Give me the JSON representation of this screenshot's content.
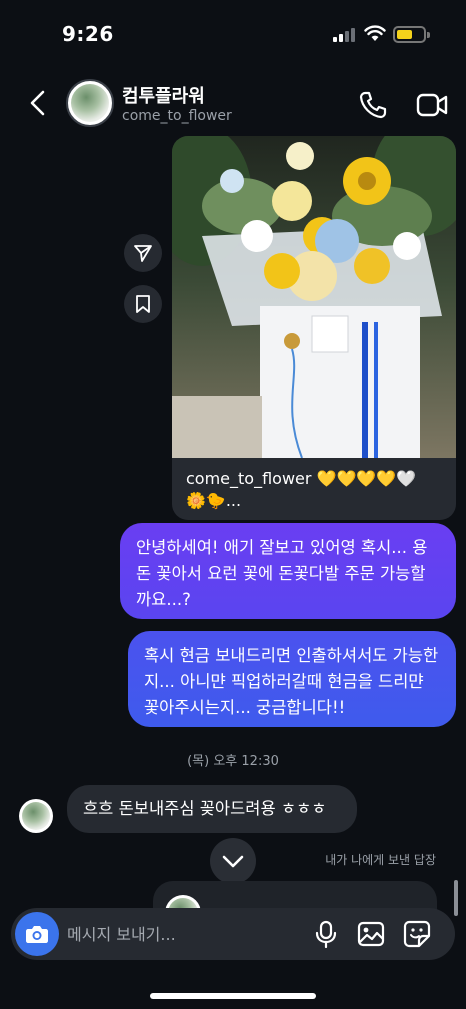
{
  "status_bar": {
    "time": "9:26",
    "battery_color": "#f4d21b"
  },
  "header": {
    "name": "컴투플라워",
    "handle": "come_to_flower",
    "icons": [
      "back-chevron-icon",
      "phone-icon",
      "video-camera-icon"
    ]
  },
  "shared_post": {
    "caption_line1": "come_to_flower 💛💛💛💛🤍",
    "caption_line2": "🌼🐤...",
    "actions": [
      "share-icon",
      "bookmark-icon"
    ]
  },
  "messages": {
    "outgoing_1": "안녕하세여! 애기 잘보고 있어영 혹시... 용돈 꽃아서 요런 꽃에 돈꽃다발 주문 가능할까요...?",
    "outgoing_2": "혹시 현금 보내드리면 인출하셔서도 가능한지... 아니먄 픽업하러갈때 현금을 드리먄 꽃아주시는지... 궁금합니다!!",
    "timestamp": "(목) 오후 12:30",
    "incoming_1": "흐흐 돈보내주심 꽂아드려용 ㅎㅎㅎ",
    "reply_note": "내가 나에게 보낸 답장"
  },
  "composer": {
    "placeholder": "메시지 보내기...",
    "accent_color": "#3b74ec",
    "icons": [
      "camera-icon",
      "microphone-icon",
      "image-icon",
      "sticker-icon"
    ]
  },
  "colors": {
    "background": "#0c0f14",
    "bubble_outgoing_top": "#6a3ef2",
    "bubble_outgoing_bottom": "#3f5bed",
    "bubble_incoming": "#262a31"
  }
}
